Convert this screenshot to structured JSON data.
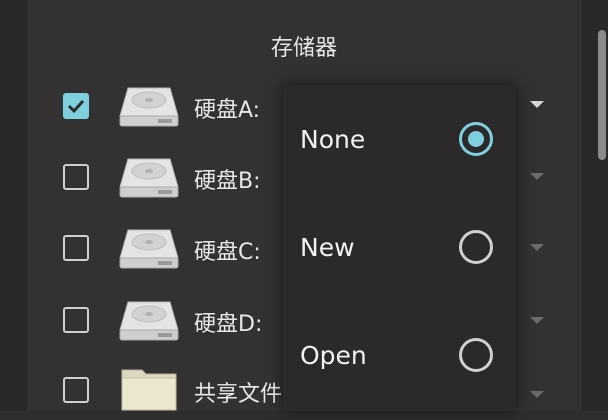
{
  "dialog": {
    "title": "存储器"
  },
  "drives": [
    {
      "label": "硬盘A:",
      "checked": true,
      "icon": "hard-disk-icon"
    },
    {
      "label": "硬盘B:",
      "checked": false,
      "icon": "hard-disk-icon"
    },
    {
      "label": "硬盘C:",
      "checked": false,
      "icon": "hard-disk-icon"
    },
    {
      "label": "硬盘D:",
      "checked": false,
      "icon": "hard-disk-icon"
    },
    {
      "label": "共享文件",
      "checked": false,
      "icon": "folder-icon"
    }
  ],
  "popup": {
    "options": [
      {
        "label": "None",
        "selected": true
      },
      {
        "label": "New",
        "selected": false
      },
      {
        "label": "Open",
        "selected": false
      }
    ]
  },
  "colors": {
    "accent": "#7fd0de",
    "background": "#333131",
    "popup": "#2b2929"
  }
}
